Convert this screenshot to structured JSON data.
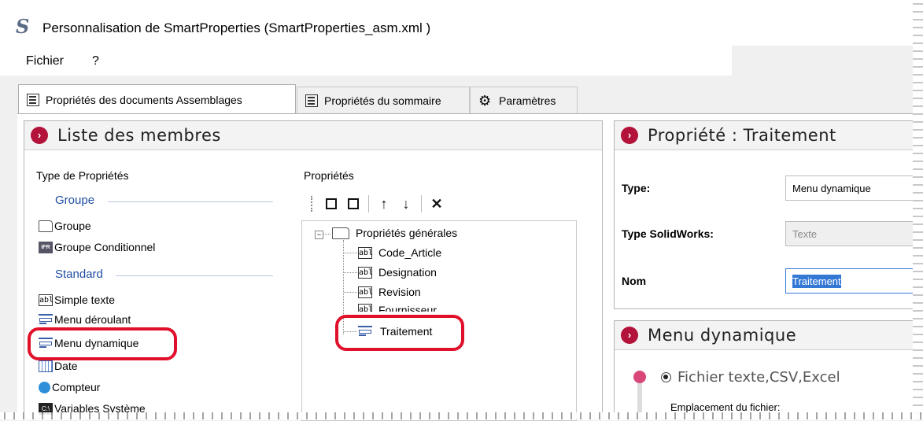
{
  "window": {
    "title": "Personnalisation de SmartProperties (SmartProperties_asm.xml )"
  },
  "menu": {
    "items": [
      "Fichier",
      "?"
    ]
  },
  "tabs": [
    {
      "label": "Propriétés des documents Assemblages",
      "icon": "list-icon",
      "active": true
    },
    {
      "label": "Propriétés du sommaire",
      "icon": "list-icon",
      "active": false
    },
    {
      "label": "Paramètres",
      "icon": "gear-icon",
      "active": false
    }
  ],
  "members_panel": {
    "title": "Liste des membres",
    "types_header": "Type de Propriétés",
    "props_header": "Propriétés",
    "groups": [
      {
        "label": "Groupe",
        "items": [
          {
            "label": "Groupe",
            "icon": "folder-icon"
          },
          {
            "label": "Groupe Conditionnel",
            "icon": "conditional-group-icon"
          }
        ]
      },
      {
        "label": "Standard",
        "items": [
          {
            "label": "Simple texte",
            "icon": "text-field-icon"
          },
          {
            "label": "Menu déroulant",
            "icon": "dropdown-icon"
          },
          {
            "label": "Menu dynamique",
            "icon": "dynamic-menu-icon"
          },
          {
            "label": "Date",
            "icon": "calendar-icon"
          },
          {
            "label": "Compteur",
            "icon": "counter-icon"
          },
          {
            "label": "Variables Système",
            "icon": "system-variable-icon"
          }
        ]
      }
    ],
    "tree": {
      "root": "Propriétés générales",
      "children": [
        "Code_Article",
        "Designation",
        "Revision",
        "Fournisseur",
        "Traitement"
      ]
    }
  },
  "property_panel": {
    "title": "Propriété : Traitement",
    "type_label": "Type:",
    "type_value": "Menu dynamique",
    "sw_type_label": "Type SolidWorks:",
    "sw_type_value": "Texte",
    "name_label": "Nom",
    "name_value": "Traitement"
  },
  "dynamic_panel": {
    "title": "Menu dynamique",
    "option_label": "Fichier texte,CSV,Excel",
    "file_location_label": "Emplacement du fichier:"
  },
  "colors": {
    "accent": "#b3123a",
    "highlight": "#e0102a",
    "group_label": "#1f4ea3"
  }
}
